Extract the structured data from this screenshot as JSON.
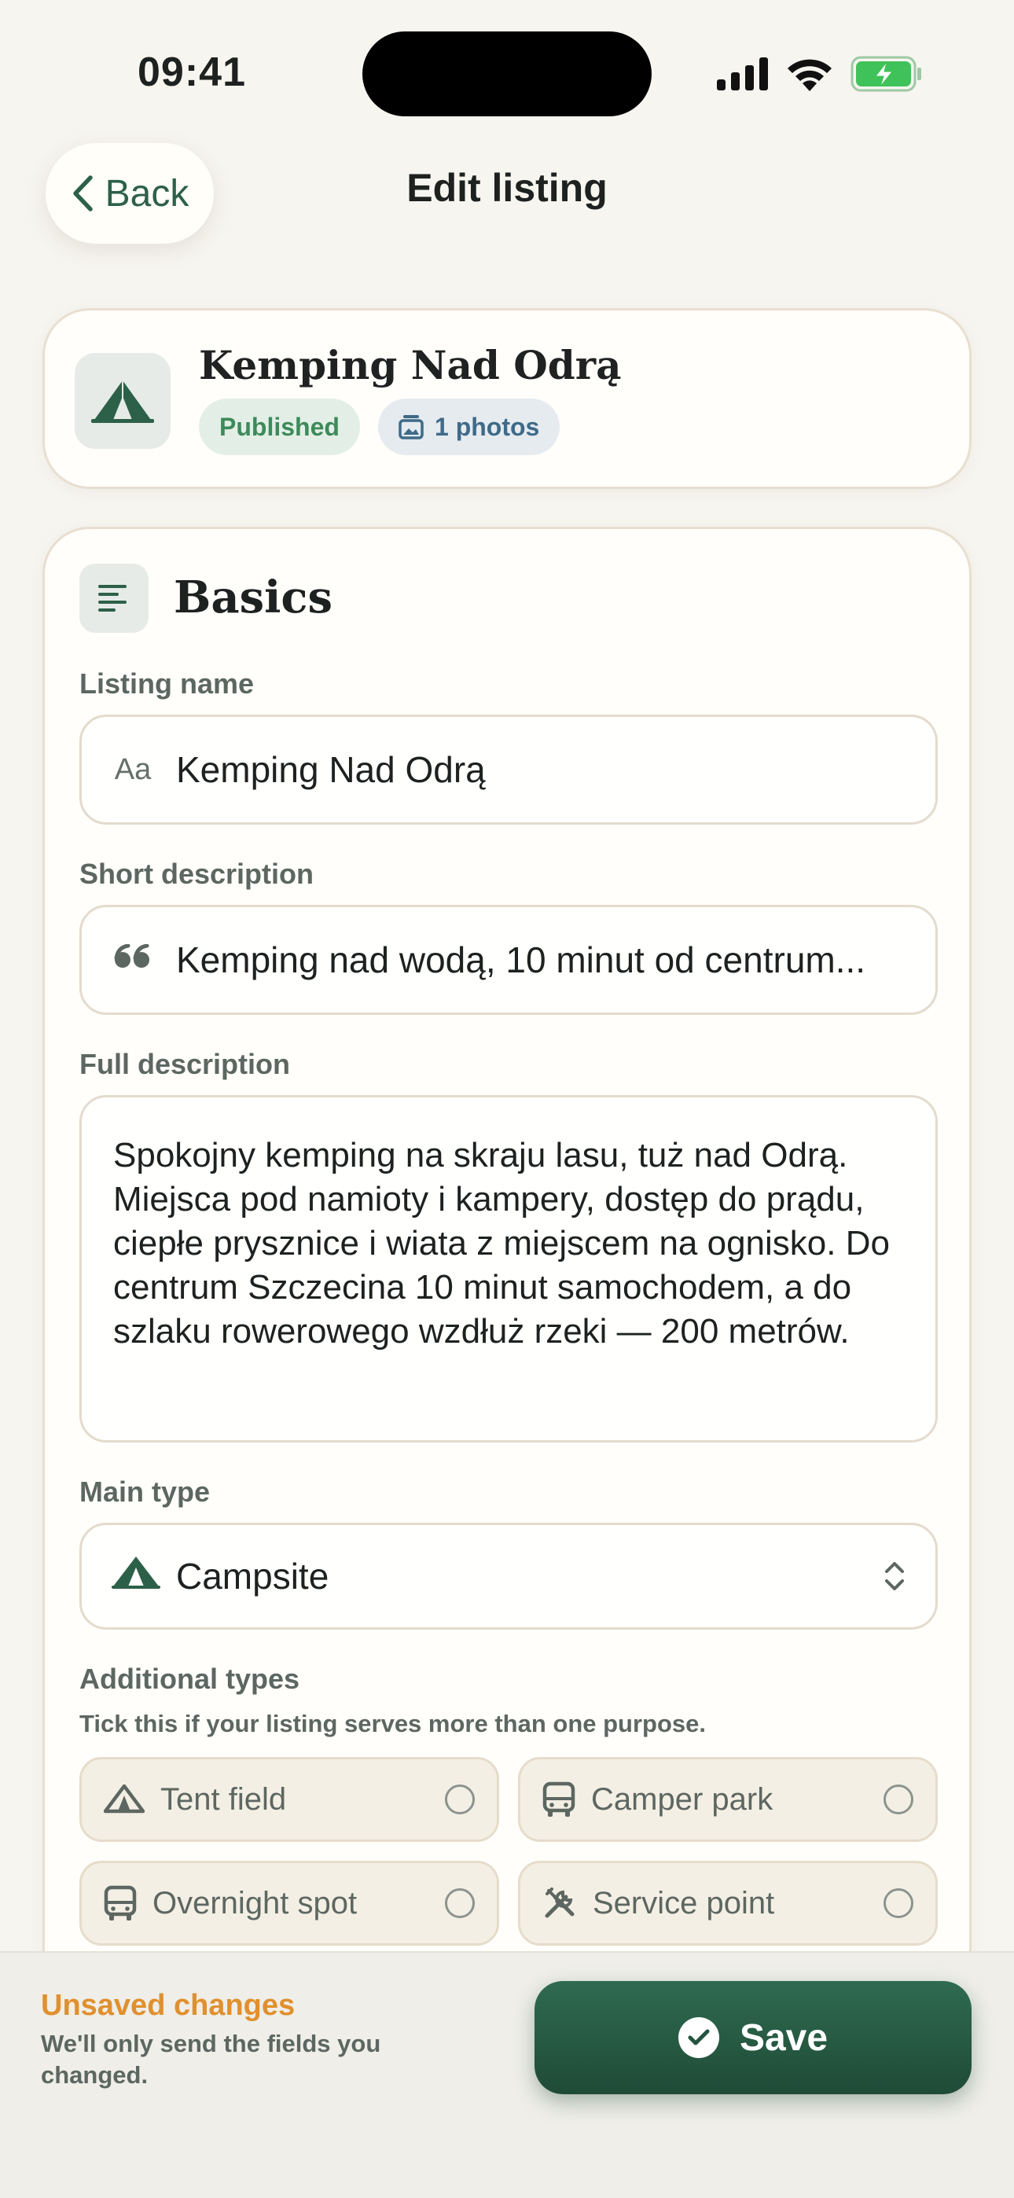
{
  "status_bar": {
    "time": "09:41"
  },
  "header": {
    "back_label": "Back",
    "title": "Edit listing"
  },
  "summary": {
    "name": "Kemping Nad Odrą",
    "status_badge": "Published",
    "photos_badge": "1 photos"
  },
  "basics": {
    "title": "Basics",
    "listing_name": {
      "label": "Listing name",
      "prefix": "Aa",
      "value": "Kemping Nad Odrą"
    },
    "short_description": {
      "label": "Short description",
      "value": "Kemping nad wodą, 10 minut od centrum..."
    },
    "full_description": {
      "label": "Full description",
      "value": "Spokojny kemping na skraju lasu, tuż nad Odrą. Miejsca pod namioty i kampery, dostęp do prądu, ciepłe prysznice i wiata z miejscem na ognisko. Do centrum Szczecina 10 minut samochodem, a do szlaku rowerowego wzdłuż rzeki — 200 metrów."
    },
    "main_type": {
      "label": "Main type",
      "value": "Campsite"
    },
    "additional_types": {
      "label": "Additional types",
      "hint": "Tick this if your listing serves more than one purpose.",
      "options": [
        {
          "label": "Tent field",
          "icon": "tent-icon",
          "checked": false
        },
        {
          "label": "Camper park",
          "icon": "bus-icon",
          "checked": false
        },
        {
          "label": "Overnight spot",
          "icon": "bus-icon",
          "checked": false
        },
        {
          "label": "Service point",
          "icon": "tools-icon",
          "checked": false
        }
      ]
    }
  },
  "footer": {
    "unsaved_title": "Unsaved changes",
    "unsaved_sub": "We'll only send the fields you changed.",
    "save_label": "Save"
  },
  "colors": {
    "accent": "#2d6049",
    "background": "#f7f5ef",
    "warning": "#e0902e",
    "published": "#3d8a5a",
    "photos": "#3f6a88"
  }
}
